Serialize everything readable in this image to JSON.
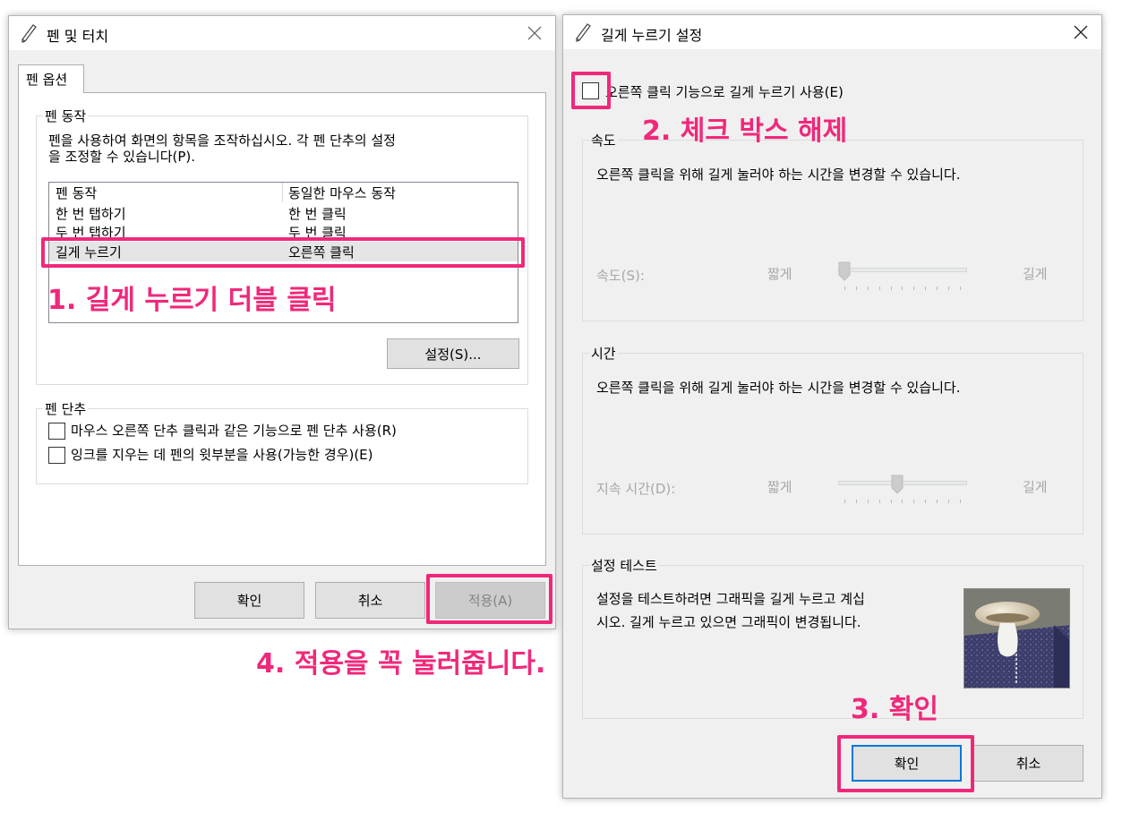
{
  "left_window": {
    "title": "펜 및 터치",
    "tab_label": "펜 옵션",
    "pen_action_group": {
      "label": "펜 동작",
      "description_line1": "펜을 사용하여 화면의 항목을 조작하십시오. 각 펜 단추의 설정",
      "description_line2": "을 조정할 수 있습니다(P).",
      "table": {
        "headers": [
          "펜 동작",
          "동일한 마우스 동작"
        ],
        "rows": [
          [
            "한 번 탭하기",
            "한 번 클릭"
          ],
          [
            "두 번 탭하기",
            "두 번 클릭"
          ],
          [
            "길게 누르기",
            "오른쪽 클릭"
          ]
        ],
        "selected_row": 2
      },
      "settings_button": "설정(S)..."
    },
    "pen_button_group": {
      "label": "펜 단추",
      "option1": "마우스 오른쪽 단추 클릭과 같은 기능으로 펜 단추 사용(R)",
      "option2": "잉크를 지우는 데 펜의 윗부분을 사용(가능한 경우)(E)"
    },
    "buttons": {
      "ok": "확인",
      "cancel": "취소",
      "apply": "적용(A)"
    }
  },
  "right_window": {
    "title": "길게 누르기 설정",
    "enable_checkbox_label": "오른쪽 클릭 기능으로 길게 누르기 사용(E)",
    "enable_checkbox_checked": false,
    "speed_group": {
      "label": "속도",
      "description": "오른쪽 클릭을 위해 길게 눌러야 하는 시간을 변경할 수 있습니다.",
      "slider_label": "속도(S):",
      "min_label": "짧게",
      "max_label": "길게",
      "slider_value": 0.0
    },
    "time_group": {
      "label": "시간",
      "description": "오른쪽 클릭을 위해 길게 눌러야 하는 시간을 변경할 수 있습니다.",
      "slider_label": "지속 시간(D):",
      "min_label": "짧게",
      "max_label": "길게",
      "slider_value": 0.45
    },
    "test_group": {
      "label": "설정 테스트",
      "description_line1": "설정을 테스트하려면 그래픽을 길게 누르고 계십",
      "description_line2": "시오. 길게 누르고 있으면 그래픽이 변경됩니다."
    },
    "buttons": {
      "ok": "확인",
      "cancel": "취소"
    }
  },
  "annotations": {
    "step1": "1. 길게 누르기 더블 클릭",
    "step2": "2. 체크 박스 해제",
    "step3": "3. 확인",
    "step4": "4. 적용을 꼭 눌러줍니다."
  },
  "colors": {
    "highlight": "#f0287a",
    "focus_blue": "#0078d7"
  }
}
